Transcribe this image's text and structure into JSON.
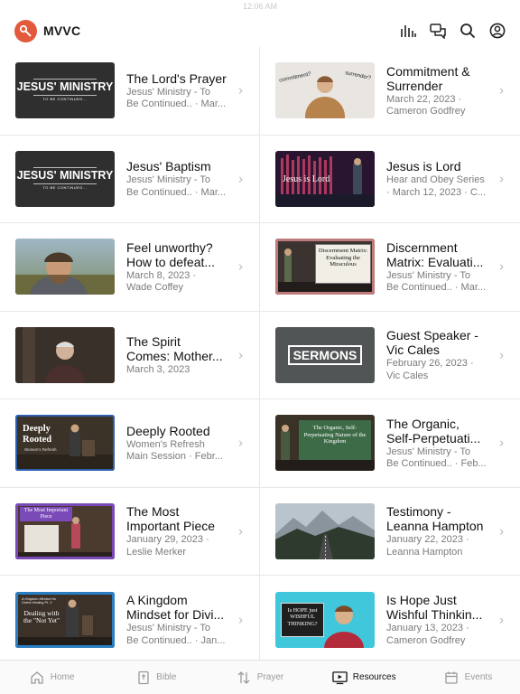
{
  "status": {
    "time": "12:06 AM"
  },
  "header": {
    "brand": "MVVC",
    "icons": [
      "equalizer-icon",
      "chat-icon",
      "search-icon",
      "account-icon"
    ]
  },
  "items": [
    {
      "title": "The Lord's Prayer",
      "meta1": "Jesus' Ministry - To",
      "meta2": "Be Continued.. · Mar...",
      "thumb": "jesus-ministry"
    },
    {
      "title": "Commitment & Surrender",
      "meta1": "March 22, 2023 ·",
      "meta2": "Cameron Godfrey",
      "thumb": "commitment"
    },
    {
      "title": "Jesus' Baptism",
      "meta1": "Jesus' Ministry - To",
      "meta2": "Be Continued.. · Mar...",
      "thumb": "jesus-ministry"
    },
    {
      "title": "Jesus is Lord",
      "meta1": "Hear and Obey Series",
      "meta2": "· March 12, 2023 · C...",
      "thumb": "jesus-lord"
    },
    {
      "title": "Feel unworthy? How to defeat...",
      "meta1": "March 8, 2023 ·",
      "meta2": "Wade Coffey",
      "thumb": "face"
    },
    {
      "title": "Discernment Matrix: Evaluati...",
      "meta1": "Jesus' Ministry - To",
      "meta2": "Be Continued.. · Mar...",
      "thumb": "discernment"
    },
    {
      "title": "The Spirit Comes: Mother...",
      "meta1": "March 3, 2023",
      "meta2": "",
      "thumb": "speaker"
    },
    {
      "title": "Guest Speaker - Vic Cales",
      "meta1": "February 26, 2023 ·",
      "meta2": "Vic Cales",
      "thumb": "sermons"
    },
    {
      "title": "Deeply Rooted",
      "meta1": "Women's Refresh",
      "meta2": "Main Session · Febr...",
      "thumb": "deeply"
    },
    {
      "title": "The Organic, Self-Perpetuati...",
      "meta1": "Jesus' Ministry - To",
      "meta2": "Be Continued.. · Feb...",
      "thumb": "organic"
    },
    {
      "title": "The Most Important Piece",
      "meta1": "January 29, 2023 ·",
      "meta2": "Leslie Merker",
      "thumb": "piece"
    },
    {
      "title": "Testimony - Leanna Hampton",
      "meta1": "January 22, 2023 ·",
      "meta2": "Leanna Hampton",
      "thumb": "road"
    },
    {
      "title": "A Kingdom Mindset for Divi...",
      "meta1": "Jesus' Ministry - To",
      "meta2": "Be Continued.. · Jan...",
      "thumb": "kingdom"
    },
    {
      "title": "Is Hope Just Wishful Thinkin...",
      "meta1": "January 13, 2023 ·",
      "meta2": "Cameron Godfrey",
      "thumb": "hope"
    }
  ],
  "thumb_text": {
    "jesus_ministry": "JESUS' MINISTRY",
    "to_be_continued": "TO BE CONTINUED...",
    "commitment": "commitment?",
    "surrender": "surrender?",
    "jesus_lord": "Jesus is Lord",
    "discernment": "Discernment Matrix: Evaluating the Miraculous",
    "sermons": "SERMONS",
    "deeply": "Deeply Rooted",
    "womens": "Women's Refresh",
    "organic": "The Organic, Self-Perpetuating Nature of the Kingdom",
    "piece": "The Most Important Piece",
    "kingdom": "A Kingdom Mindset for Divine Healing Pt. 3",
    "dealing": "Dealing with the \"Not Yet\"",
    "hope": "Is HOPE just WISHFUL THINKING?"
  },
  "tabs": [
    {
      "label": "Home",
      "icon": "home-icon"
    },
    {
      "label": "Bible",
      "icon": "bible-icon"
    },
    {
      "label": "Prayer",
      "icon": "prayer-icon"
    },
    {
      "label": "Resources",
      "icon": "resources-icon",
      "active": true
    },
    {
      "label": "Events",
      "icon": "calendar-icon"
    }
  ],
  "colors": {
    "brand": "#e2593c",
    "active_tab": "#111111",
    "inactive_tab": "#9a9a9a"
  }
}
